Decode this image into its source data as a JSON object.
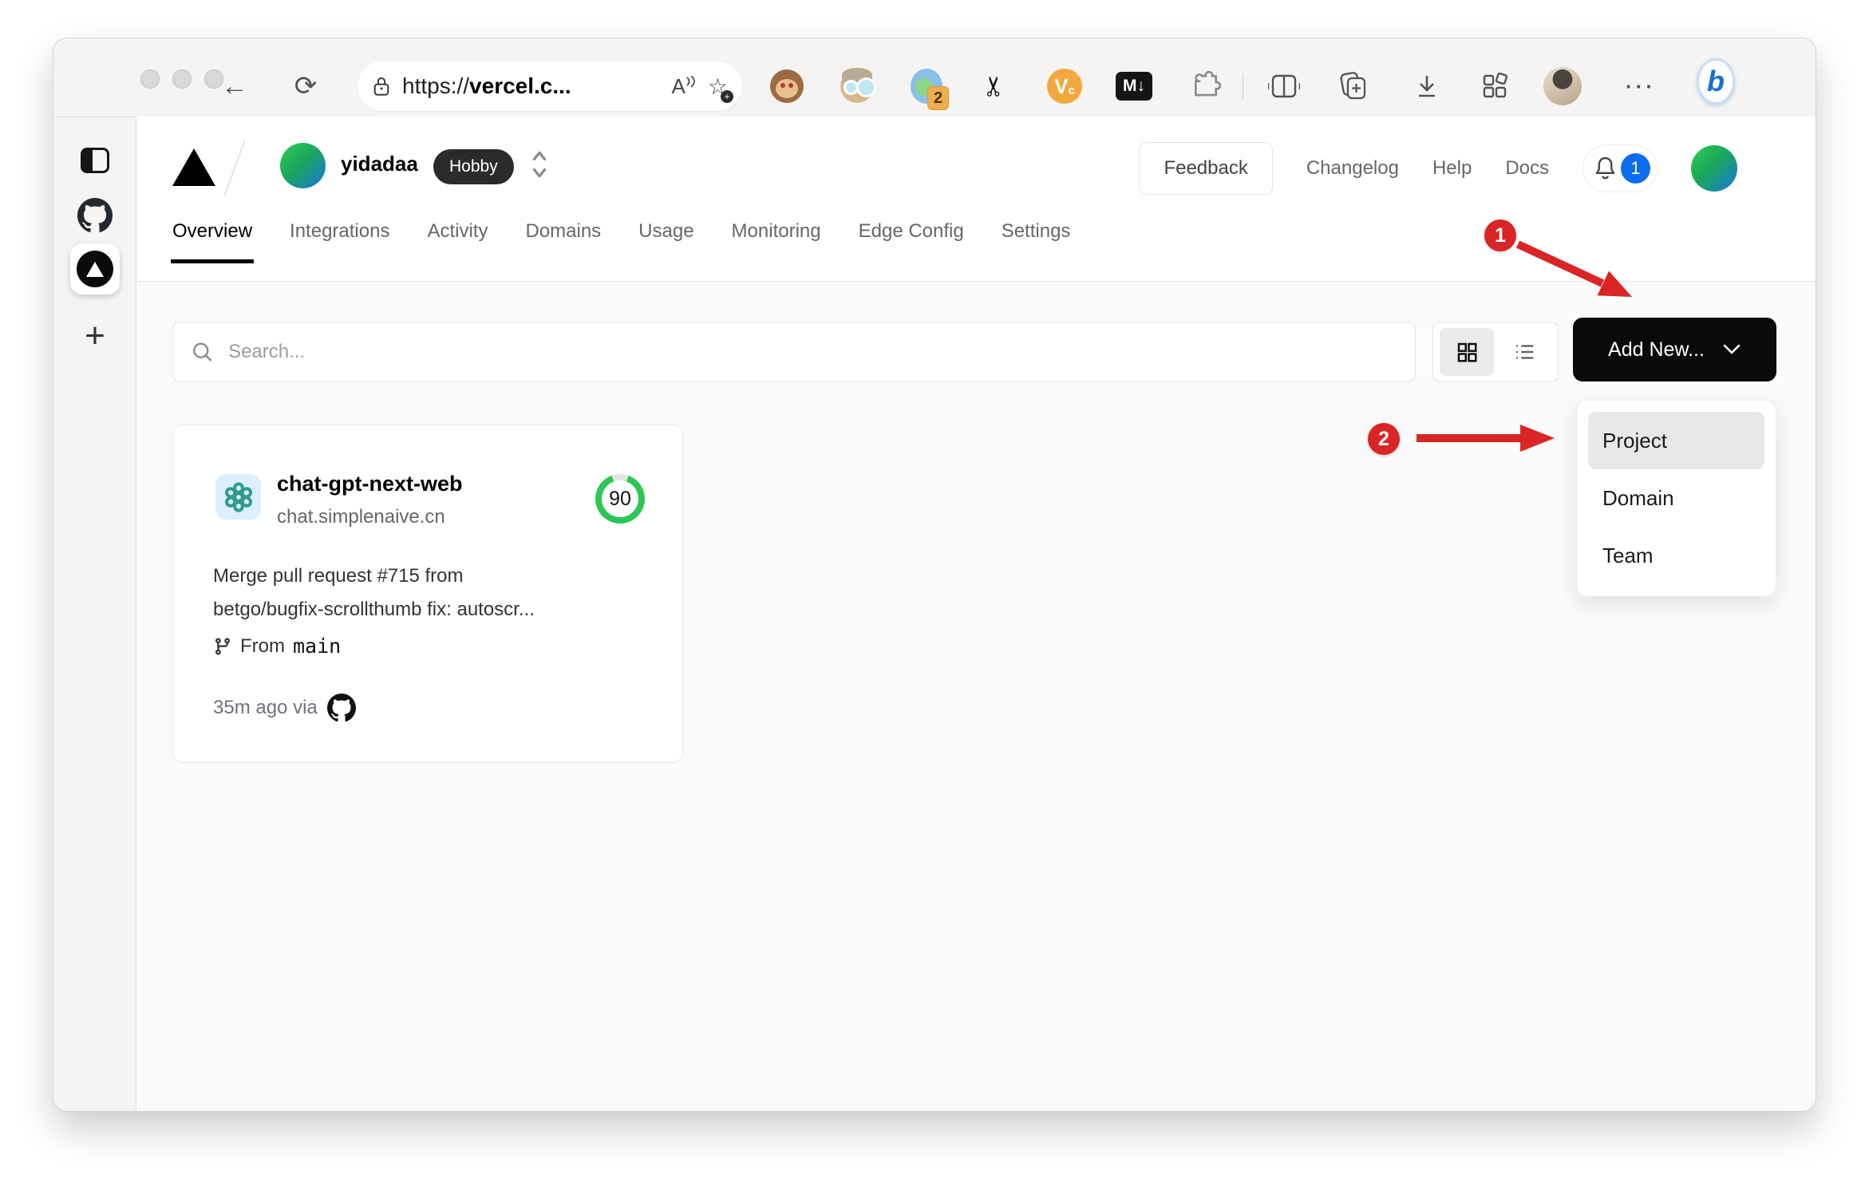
{
  "colors": {
    "annotation_red": "#d92525",
    "accent_blue": "#0b6cee",
    "score_green": "#2bc653",
    "openai_teal": "#319c8e"
  },
  "browser": {
    "back_glyph": "←",
    "refresh_glyph": "⟳",
    "url": {
      "scheme": "https://",
      "host": "vercel.c..."
    },
    "reader_label": "A",
    "extensions": {
      "orb_badge": "2",
      "v_label": "V",
      "v_sub": "c",
      "markdown_label": "M↓"
    },
    "more_glyph": "···",
    "bing_label": "b"
  },
  "sidebar": {
    "plus_glyph": "+"
  },
  "header": {
    "team": "yidadaa",
    "plan": "Hobby",
    "feedback": "Feedback",
    "changelog": "Changelog",
    "help": "Help",
    "docs": "Docs",
    "notifications": "1"
  },
  "tabs": [
    {
      "label": "Overview"
    },
    {
      "label": "Integrations"
    },
    {
      "label": "Activity"
    },
    {
      "label": "Domains"
    },
    {
      "label": "Usage"
    },
    {
      "label": "Monitoring"
    },
    {
      "label": "Edge Config"
    },
    {
      "label": "Settings"
    }
  ],
  "toolbar": {
    "search_placeholder": "Search...",
    "add_new": "Add New..."
  },
  "dropdown": {
    "items": [
      "Project",
      "Domain",
      "Team"
    ],
    "selected": "Project"
  },
  "annotations": {
    "step1": "1",
    "step2": "2"
  },
  "project_card": {
    "name": "chat-gpt-next-web",
    "domain": "chat.simplenaive.cn",
    "score": "90",
    "commit_line1": "Merge pull request #715 from",
    "commit_line2": "betgo/bugfix-scrollthumb fix: autoscr...",
    "branch_prefix": "From",
    "branch": "main",
    "time": "35m ago via"
  }
}
